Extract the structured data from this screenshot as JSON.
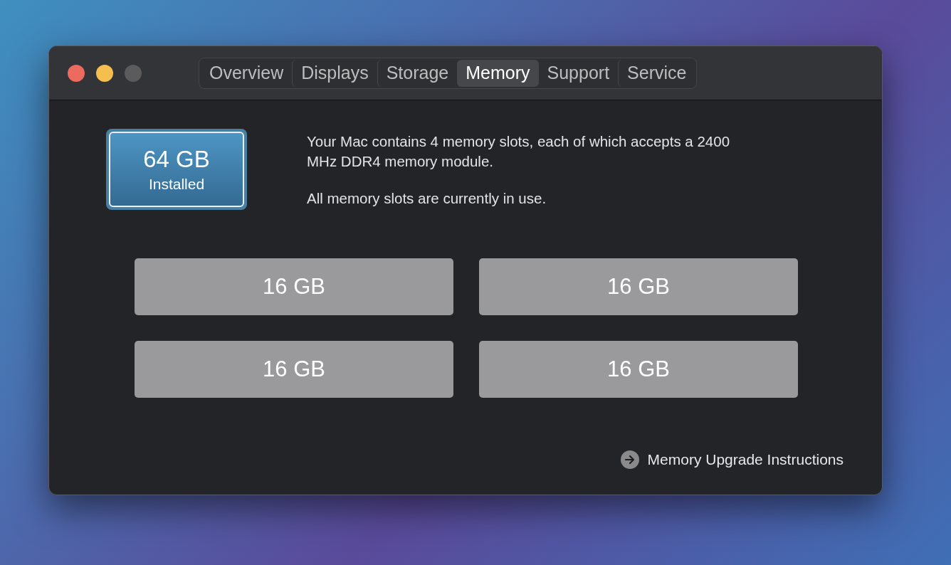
{
  "tabs": [
    {
      "label": "Overview",
      "selected": false
    },
    {
      "label": "Displays",
      "selected": false
    },
    {
      "label": "Storage",
      "selected": false
    },
    {
      "label": "Memory",
      "selected": true
    },
    {
      "label": "Support",
      "selected": false
    },
    {
      "label": "Service",
      "selected": false
    }
  ],
  "installed": {
    "amount": "64 GB",
    "label": "Installed"
  },
  "description": [
    "Your Mac contains 4 memory slots, each of which accepts a 2400 MHz DDR4 memory module.",
    "All memory slots are currently in use."
  ],
  "slots": [
    "16 GB",
    "16 GB",
    "16 GB",
    "16 GB"
  ],
  "link": "Memory Upgrade Instructions"
}
